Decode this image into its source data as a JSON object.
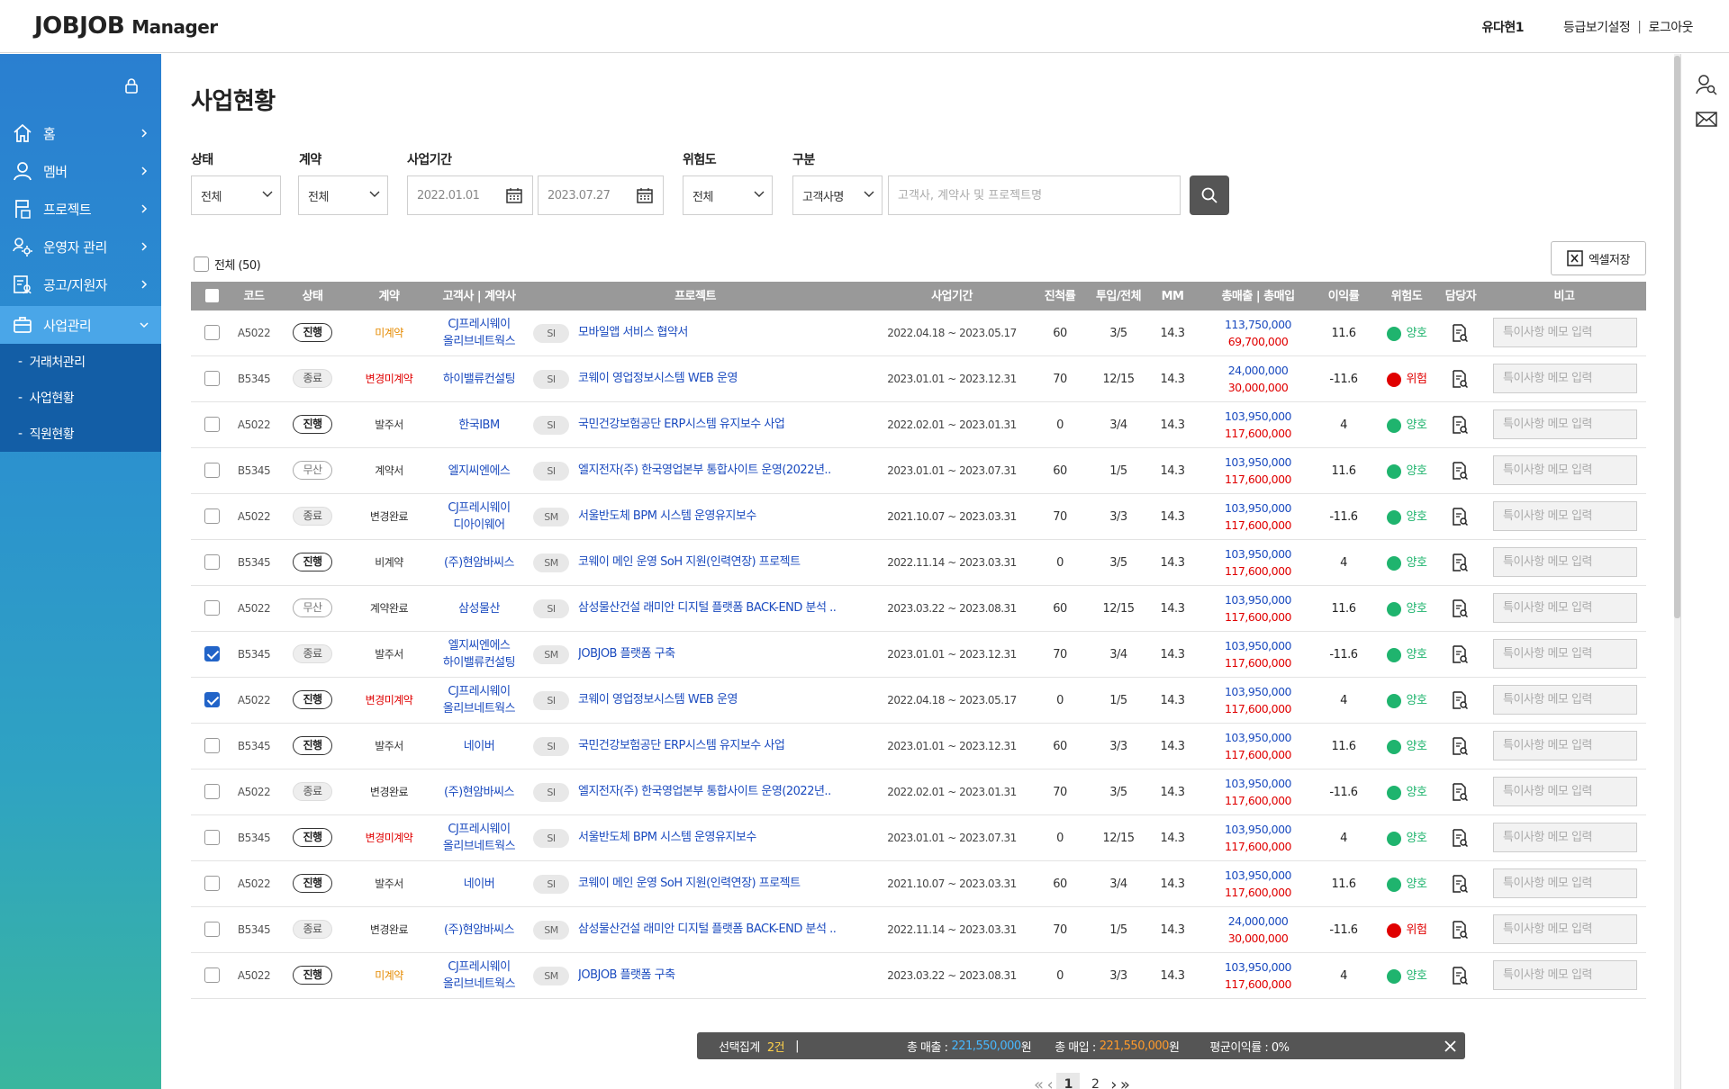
{
  "header": {
    "logo_main": "JOBJOB",
    "logo_sub": "Manager",
    "user": "유다현1",
    "link_grade": "등급보기설정",
    "sep": "|",
    "link_logout": "로그아웃"
  },
  "sidebar": {
    "menu": [
      {
        "label": "홈",
        "icon": "home-icon"
      },
      {
        "label": "멤버",
        "icon": "person-icon"
      },
      {
        "label": "프로젝트",
        "icon": "project-flag-icon"
      },
      {
        "label": "운영자 관리",
        "icon": "admin-gear-icon"
      },
      {
        "label": "공고/지원자",
        "icon": "notice-document-icon"
      },
      {
        "label": "사업관리",
        "icon": "briefcase-icon"
      }
    ],
    "submenu": [
      "거래처관리",
      "사업현황",
      "직원현황"
    ]
  },
  "page": {
    "title": "사업현황"
  },
  "filters": {
    "status_label": "상태",
    "status_value": "전체",
    "contract_label": "계약",
    "contract_value": "전체",
    "period_label": "사업기간",
    "period_start": "2022.01.01",
    "period_end": "2023.07.27",
    "risk_label": "위험도",
    "risk_value": "전체",
    "type_label": "구분",
    "type_value": "고객사명",
    "search_placeholder": "고객사, 계약사 및 프로젝트명"
  },
  "select_all": "전체 (50)",
  "excel_label": "엑셀저장",
  "table": {
    "headers": [
      "코드",
      "상태",
      "계약",
      "고객사 | 계약사",
      "프로젝트",
      "사업기간",
      "진척률",
      "투입/전체",
      "MM",
      "총매출 | 총매입",
      "이익률",
      "위험도",
      "담당자",
      "비고"
    ],
    "memo_placeholder": "특이사항 메모 입력",
    "rows": [
      {
        "checked": false,
        "code": "A5022",
        "status": "진행",
        "st": "ing",
        "contract": "미계약",
        "cc": "orange",
        "client": [
          "CJ프레시웨이",
          "올리브네트웍스"
        ],
        "tag": "SI",
        "project": "모바일앱 서비스 협약서",
        "period": "2022.04.18 ~ 2023.05.17",
        "progress": "60",
        "input": "3/5",
        "mm": "14.3",
        "sales": "113,750,000",
        "purchase": "69,700,000",
        "margin": "11.6",
        "risk": "양호",
        "rk": "g"
      },
      {
        "checked": false,
        "code": "B5345",
        "status": "종료",
        "st": "end",
        "contract": "변경미계약",
        "cc": "red",
        "client": [
          "하이밸류컨설팅"
        ],
        "tag": "SI",
        "project": "코웨이 영업정보시스템 WEB 운영",
        "period": "2023.01.01 ~ 2023.12.31",
        "progress": "70",
        "input": "12/15",
        "mm": "14.3",
        "sales": "24,000,000",
        "purchase": "30,000,000",
        "margin": "-11.6",
        "risk": "위험",
        "rk": "r"
      },
      {
        "checked": false,
        "code": "A5022",
        "status": "진행",
        "st": "ing",
        "contract": "발주서",
        "cc": "",
        "client": [
          "한국IBM"
        ],
        "tag": "SI",
        "project": "국민건강보험공단 ERP시스템 유지보수 사업",
        "period": "2022.02.01 ~ 2023.01.31",
        "progress": "0",
        "input": "3/4",
        "mm": "14.3",
        "sales": "103,950,000",
        "purchase": "117,600,000",
        "margin": "4",
        "risk": "양호",
        "rk": "g"
      },
      {
        "checked": false,
        "code": "B5345",
        "status": "무산",
        "st": "none",
        "contract": "계약서",
        "cc": "",
        "client": [
          "엘지씨엔에스"
        ],
        "tag": "SI",
        "project": "엘지전자(주) 한국영업본부 통합사이트 운영(2022년..",
        "period": "2023.01.01 ~ 2023.07.31",
        "progress": "60",
        "input": "1/5",
        "mm": "14.3",
        "sales": "103,950,000",
        "purchase": "117,600,000",
        "margin": "11.6",
        "risk": "양호",
        "rk": "g"
      },
      {
        "checked": false,
        "code": "A5022",
        "status": "종료",
        "st": "end",
        "contract": "변경완료",
        "cc": "",
        "client": [
          "CJ프레시웨이",
          "디아이웨어"
        ],
        "tag": "SM",
        "project": "서울반도체 BPM 시스템 운영유지보수",
        "period": "2021.10.07 ~ 2023.03.31",
        "progress": "70",
        "input": "3/3",
        "mm": "14.3",
        "sales": "103,950,000",
        "purchase": "117,600,000",
        "margin": "-11.6",
        "risk": "양호",
        "rk": "g"
      },
      {
        "checked": false,
        "code": "B5345",
        "status": "진행",
        "st": "ing",
        "contract": "비계약",
        "cc": "",
        "client": [
          "(주)현암바씨스"
        ],
        "tag": "SM",
        "project": "코웨이 메인 운영 SoH 지원(인력연장) 프로젝트",
        "period": "2022.11.14 ~ 2023.03.31",
        "progress": "0",
        "input": "3/5",
        "mm": "14.3",
        "sales": "103,950,000",
        "purchase": "117,600,000",
        "margin": "4",
        "risk": "양호",
        "rk": "g"
      },
      {
        "checked": false,
        "code": "A5022",
        "status": "무산",
        "st": "none",
        "contract": "계약완료",
        "cc": "",
        "client": [
          "삼성물산"
        ],
        "tag": "SI",
        "project": "삼성물산건설 래미안 디지털 플랫폼 BACK-END 분석 ..",
        "period": "2023.03.22 ~ 2023.08.31",
        "progress": "60",
        "input": "12/15",
        "mm": "14.3",
        "sales": "103,950,000",
        "purchase": "117,600,000",
        "margin": "11.6",
        "risk": "양호",
        "rk": "g"
      },
      {
        "checked": true,
        "code": "B5345",
        "status": "종료",
        "st": "end",
        "contract": "발주서",
        "cc": "",
        "client": [
          "엘지씨엔에스",
          "하이밸류컨설팅"
        ],
        "tag": "SM",
        "project": "JOBJOB 플랫폼 구축",
        "period": "2023.01.01 ~ 2023.12.31",
        "progress": "70",
        "input": "3/4",
        "mm": "14.3",
        "sales": "103,950,000",
        "purchase": "117,600,000",
        "margin": "-11.6",
        "risk": "양호",
        "rk": "g"
      },
      {
        "checked": true,
        "code": "A5022",
        "status": "진행",
        "st": "ing",
        "contract": "변경미계약",
        "cc": "red",
        "client": [
          "CJ프레시웨이",
          "올리브네트웍스"
        ],
        "tag": "SI",
        "project": "코웨이 영업정보시스템 WEB 운영",
        "period": "2022.04.18 ~ 2023.05.17",
        "progress": "0",
        "input": "1/5",
        "mm": "14.3",
        "sales": "103,950,000",
        "purchase": "117,600,000",
        "margin": "4",
        "risk": "양호",
        "rk": "g"
      },
      {
        "checked": false,
        "code": "B5345",
        "status": "진행",
        "st": "ing",
        "contract": "발주서",
        "cc": "",
        "client": [
          "네이버"
        ],
        "tag": "SI",
        "project": "국민건강보험공단 ERP시스템 유지보수 사업",
        "period": "2023.01.01 ~ 2023.12.31",
        "progress": "60",
        "input": "3/3",
        "mm": "14.3",
        "sales": "103,950,000",
        "purchase": "117,600,000",
        "margin": "11.6",
        "risk": "양호",
        "rk": "g"
      },
      {
        "checked": false,
        "code": "A5022",
        "status": "종료",
        "st": "end",
        "contract": "변경완료",
        "cc": "",
        "client": [
          "(주)현암바씨스"
        ],
        "tag": "SI",
        "project": "엘지전자(주) 한국영업본부 통합사이트 운영(2022년..",
        "period": "2022.02.01 ~ 2023.01.31",
        "progress": "70",
        "input": "3/5",
        "mm": "14.3",
        "sales": "103,950,000",
        "purchase": "117,600,000",
        "margin": "-11.6",
        "risk": "양호",
        "rk": "g"
      },
      {
        "checked": false,
        "code": "B5345",
        "status": "진행",
        "st": "ing",
        "contract": "변경미계약",
        "cc": "red",
        "client": [
          "CJ프레시웨이",
          "올리브네트웍스"
        ],
        "tag": "SI",
        "project": "서울반도체 BPM 시스템 운영유지보수",
        "period": "2023.01.01 ~ 2023.07.31",
        "progress": "0",
        "input": "12/15",
        "mm": "14.3",
        "sales": "103,950,000",
        "purchase": "117,600,000",
        "margin": "4",
        "risk": "양호",
        "rk": "g"
      },
      {
        "checked": false,
        "code": "A5022",
        "status": "진행",
        "st": "ing",
        "contract": "발주서",
        "cc": "",
        "client": [
          "네이버"
        ],
        "tag": "SI",
        "project": "코웨이 메인 운영 SoH 지원(인력연장) 프로젝트",
        "period": "2021.10.07 ~ 2023.03.31",
        "progress": "60",
        "input": "3/4",
        "mm": "14.3",
        "sales": "103,950,000",
        "purchase": "117,600,000",
        "margin": "11.6",
        "risk": "양호",
        "rk": "g"
      },
      {
        "checked": false,
        "code": "B5345",
        "status": "종료",
        "st": "end",
        "contract": "변경완료",
        "cc": "",
        "client": [
          "(주)현암바씨스"
        ],
        "tag": "SM",
        "project": "삼성물산건설 래미안 디지털 플랫폼 BACK-END 분석 ..",
        "period": "2022.11.14 ~ 2023.03.31",
        "progress": "70",
        "input": "1/5",
        "mm": "14.3",
        "sales": "24,000,000",
        "purchase": "30,000,000",
        "margin": "-11.6",
        "risk": "위험",
        "rk": "r"
      },
      {
        "checked": false,
        "code": "A5022",
        "status": "진행",
        "st": "ing",
        "contract": "미계약",
        "cc": "orange",
        "client": [
          "CJ프레시웨이",
          "올리브네트웍스"
        ],
        "tag": "SM",
        "project": "JOBJOB 플랫폼 구축",
        "period": "2023.03.22 ~ 2023.08.31",
        "progress": "0",
        "input": "3/3",
        "mm": "14.3",
        "sales": "103,950,000",
        "purchase": "117,600,000",
        "margin": "4",
        "risk": "양호",
        "rk": "g"
      }
    ]
  },
  "summary": {
    "label_selected": "선택집계",
    "count": "2건",
    "sep": "|",
    "label_sales": "총 매출 :",
    "sales": "221,550,000",
    "won1": "원",
    "label_purchase": "총 매입 :",
    "purchase": "221,550,000",
    "won2": "원",
    "label_avg": "평균이익률 : 0%"
  },
  "pager": {
    "pages": [
      "1",
      "2"
    ],
    "current": "1"
  },
  "colors": {
    "sidebar_top": "#2a7fd0",
    "sidebar_bottom": "#3ab69e",
    "active_menu": "#4aa6e8",
    "submenu_bg": "#135ea6",
    "link_blue": "#1b4bbf",
    "red": "#e00000",
    "green": "#1fb46e",
    "header_gray": "#999999"
  }
}
